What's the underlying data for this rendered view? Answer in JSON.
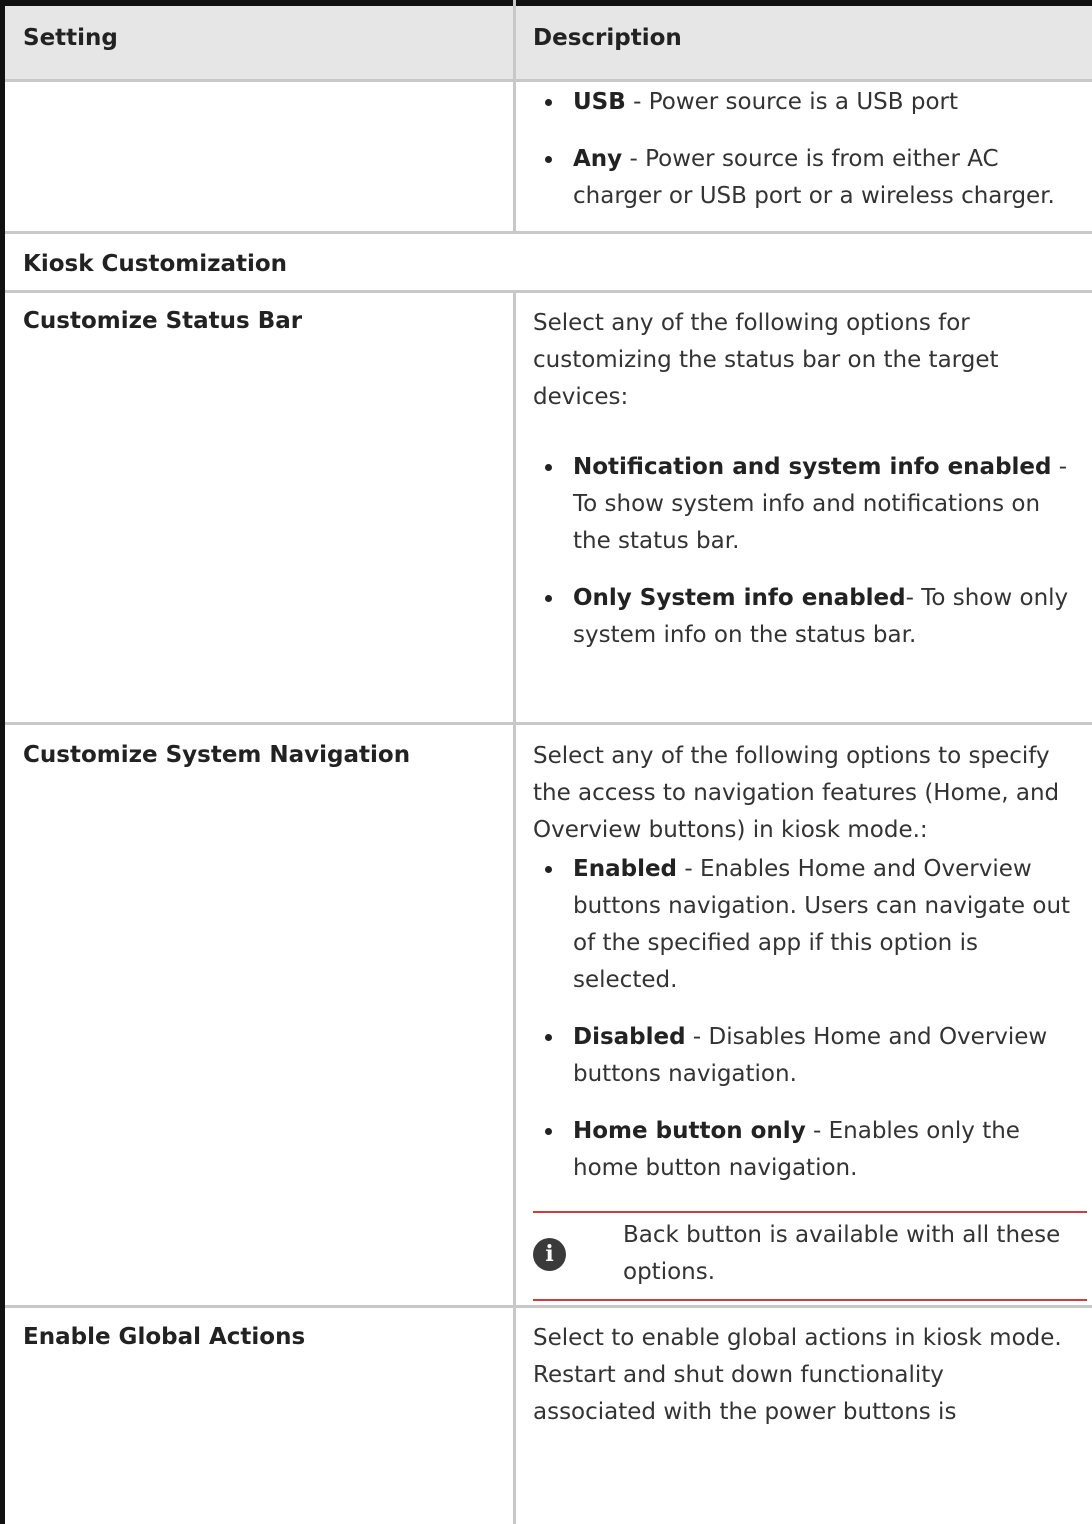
{
  "table": {
    "headers": {
      "setting": "Setting",
      "description": "Description"
    },
    "power_items": [
      {
        "term": "USB",
        "text": " - Power source is a USB port"
      },
      {
        "term": "Any",
        "text": " - Power source is from either AC charger or USB port or a wireless charger."
      }
    ],
    "section_title": "Kiosk Customization",
    "status_bar": {
      "setting": "Customize Status Bar",
      "intro": "Select any of the following options for customizing the status bar on the target devices:",
      "items": [
        {
          "term": "Notification and system info enabled",
          "text": " - To show system info and notifications on the status bar."
        },
        {
          "term": "Only System info enabled",
          "text": "- To show only system info on the status bar."
        }
      ]
    },
    "system_navigation": {
      "setting": "Customize System Navigation",
      "intro": "Select any of the following options to specify the access to navigation features (Home, and Overview buttons) in kiosk mode.:",
      "items": [
        {
          "term": "Enabled",
          "text": " - Enables Home and Overview buttons navigation. Users can navigate out of the specified app if this option is selected."
        },
        {
          "term": "Disabled",
          "text": " - Disables Home and Overview buttons navigation."
        },
        {
          "term": "Home button only",
          "text": " - Enables only the home button navigation."
        }
      ],
      "note": {
        "icon": "info-icon",
        "text": "Back button is available with all these options."
      }
    },
    "global_actions": {
      "setting": "Enable Global Actions",
      "description": "Select to enable global actions in kiosk mode. Restart and shut down functionality associated with the power buttons is"
    }
  }
}
